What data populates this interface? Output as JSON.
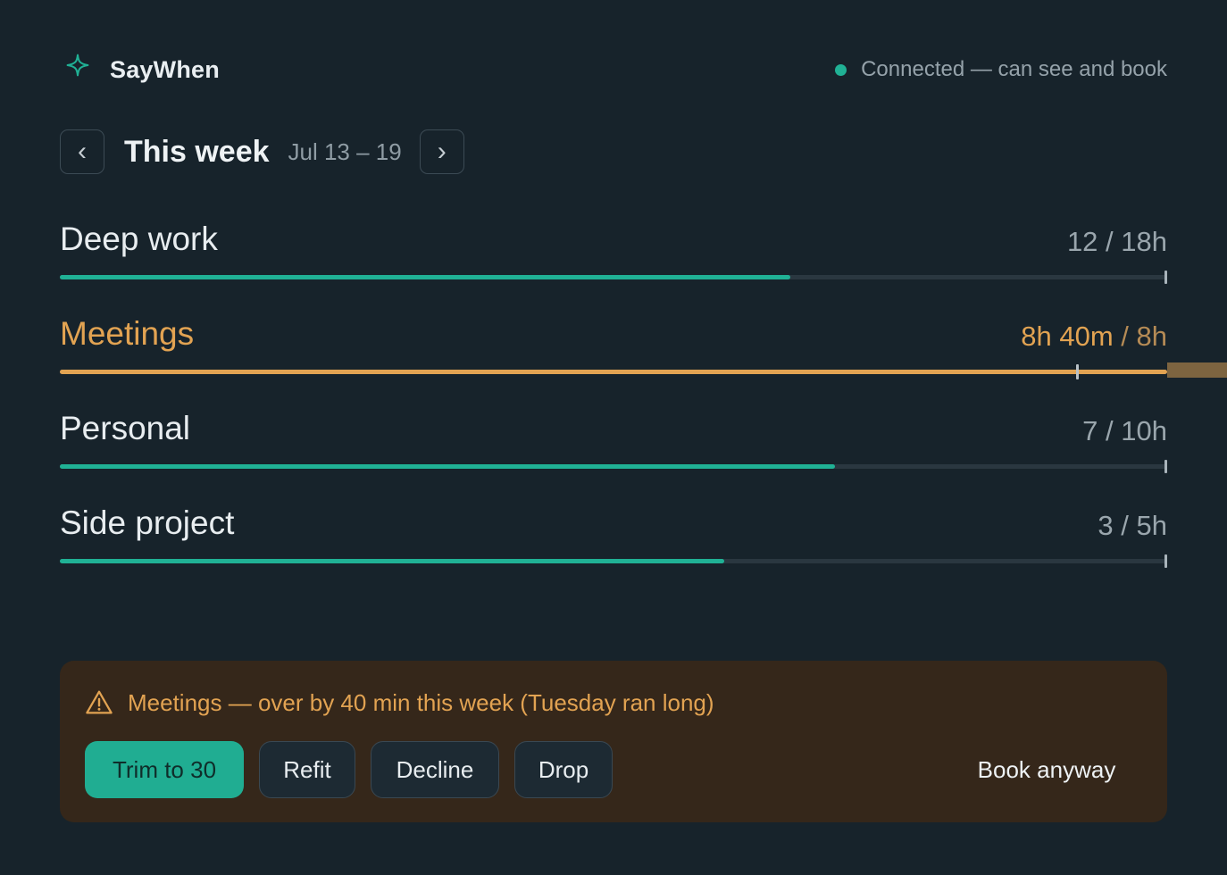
{
  "app": {
    "name": "SayWhen",
    "status_text": "Connected — can see and book",
    "accent_color": "#20b195",
    "warning_color": "#e2a352"
  },
  "week": {
    "title": "This week",
    "range": "Jul 13 – 19",
    "prev_label": "‹",
    "next_label": "›"
  },
  "budgets": [
    {
      "name": "Deep work",
      "used": "12",
      "limit": "18h",
      "separator": " / ",
      "progress": 0.66,
      "over": false
    },
    {
      "name": "Meetings",
      "used": "8h 40m",
      "limit": "8h",
      "separator": " / ",
      "progress": 1.0,
      "over": true
    },
    {
      "name": "Personal",
      "used": "7",
      "limit": "10h",
      "separator": " / ",
      "progress": 0.7,
      "over": false
    },
    {
      "name": "Side project",
      "used": "3",
      "limit": "5h",
      "separator": " / ",
      "progress": 0.6,
      "over": false
    }
  ],
  "warning": {
    "icon": "warning-triangle-icon",
    "text": "Meetings — over by 40 min this week (Tuesday ran long)",
    "actions": {
      "trim": "Trim to 30",
      "refit": "Refit",
      "decline": "Decline",
      "drop": "Drop",
      "book_anyway": "Book anyway"
    }
  }
}
